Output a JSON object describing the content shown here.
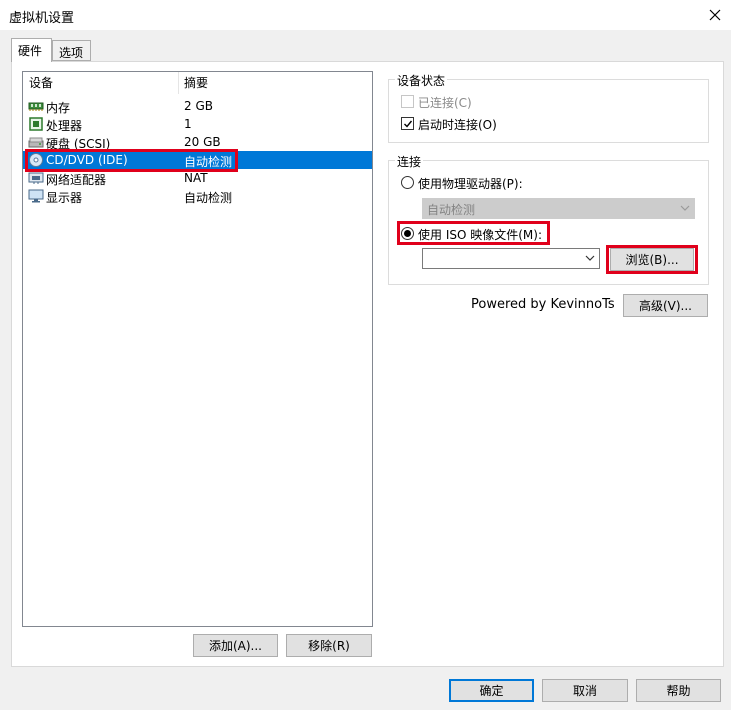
{
  "window": {
    "title": "虚拟机设置"
  },
  "tabs": [
    {
      "label": "硬件",
      "active": true
    },
    {
      "label": "选项",
      "active": false
    }
  ],
  "device_list": {
    "headers": {
      "device": "设备",
      "summary": "摘要"
    },
    "rows": [
      {
        "name": "内存",
        "summary": "2 GB",
        "icon": "memory-icon"
      },
      {
        "name": "处理器",
        "summary": "1",
        "icon": "processor-icon"
      },
      {
        "name": "硬盘 (SCSI)",
        "summary": "20 GB",
        "icon": "hard-disk-icon"
      },
      {
        "name": "CD/DVD (IDE)",
        "summary": "自动检测",
        "icon": "cd-dvd-icon",
        "selected": true
      },
      {
        "name": "网络适配器",
        "summary": "NAT",
        "icon": "network-adapter-icon"
      },
      {
        "name": "显示器",
        "summary": "自动检测",
        "icon": "display-icon"
      }
    ],
    "add_label": "添加(A)...",
    "remove_label": "移除(R)"
  },
  "device_status": {
    "label": "设备状态",
    "connected_label": "已连接(C)",
    "connected_checked": false,
    "connected_enabled": false,
    "connect_at_power_on_label": "启动时连接(O)",
    "connect_at_power_on_checked": true
  },
  "connection": {
    "label": "连接",
    "physical_drive_label": "使用物理驱动器(P):",
    "physical_drive_selected": false,
    "physical_drive_value": "自动检测",
    "iso_label": "使用 ISO 映像文件(M):",
    "iso_selected": true,
    "iso_path": "",
    "browse_label": "浏览(B)..."
  },
  "powered_by": "Powered by KevinnoTs",
  "advanced_label": "高级(V)...",
  "footer": {
    "ok_label": "确定",
    "cancel_label": "取消",
    "help_label": "帮助"
  },
  "colors": {
    "selection": "#0078d7",
    "highlight": "#e0001b"
  }
}
